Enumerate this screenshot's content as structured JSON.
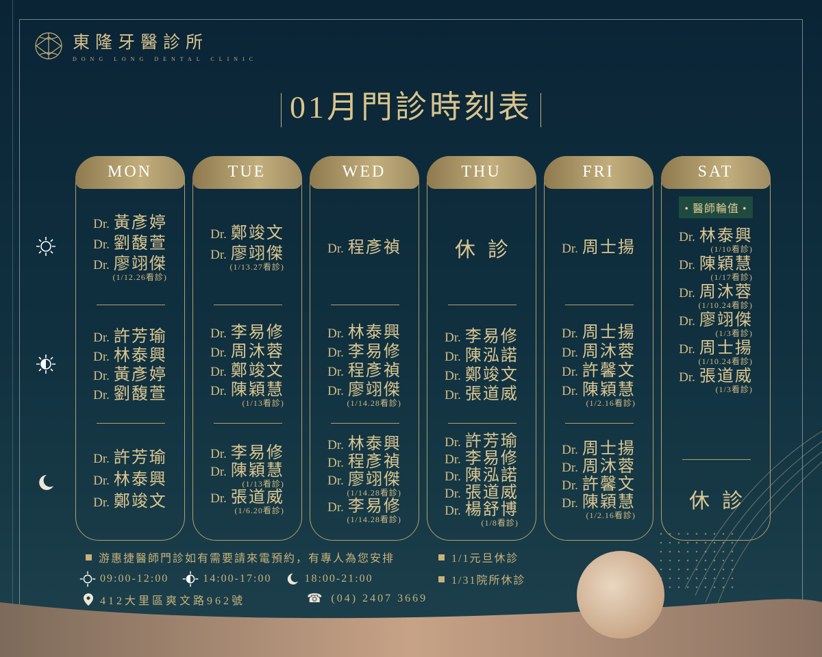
{
  "clinic": {
    "name": "東隆牙醫診所",
    "name_en": "DONG LONG DENTAL CLINIC"
  },
  "title": "01月門診時刻表",
  "prefix": "Dr.",
  "slots": [
    {
      "icon": "sun-icon"
    },
    {
      "icon": "half-sun-icon"
    },
    {
      "icon": "moon-icon"
    }
  ],
  "days": [
    {
      "label": "MON",
      "morning": [
        {
          "name": "黃彥婷"
        },
        {
          "name": "劉馥萱"
        },
        {
          "name": "廖翊傑",
          "note": "(1/12.26看診)"
        }
      ],
      "afternoon": [
        {
          "name": "許芳瑜"
        },
        {
          "name": "林泰興"
        },
        {
          "name": "黃彥婷"
        },
        {
          "name": "劉馥萱"
        }
      ],
      "evening": [
        {
          "name": "許芳瑜"
        },
        {
          "name": "林泰興"
        },
        {
          "name": "鄭竣文"
        }
      ]
    },
    {
      "label": "TUE",
      "morning": [
        {
          "name": "鄭竣文"
        },
        {
          "name": "廖翊傑",
          "note": "(1/13.27看診)"
        }
      ],
      "afternoon": [
        {
          "name": "李易修"
        },
        {
          "name": "周沐蓉"
        },
        {
          "name": "鄭竣文"
        },
        {
          "name": "陳穎慧",
          "note": "(1/13看診)"
        }
      ],
      "evening": [
        {
          "name": "李易修"
        },
        {
          "name": "陳穎慧",
          "note": "(1/13看診)"
        },
        {
          "name": "張道威",
          "note": "(1/6.20看診)"
        }
      ]
    },
    {
      "label": "WED",
      "morning": [
        {
          "name": "程彥禎"
        }
      ],
      "afternoon": [
        {
          "name": "林泰興"
        },
        {
          "name": "李易修"
        },
        {
          "name": "程彥禎"
        },
        {
          "name": "廖翊傑",
          "note": "(1/14.28看診)"
        }
      ],
      "evening": [
        {
          "name": "林泰興"
        },
        {
          "name": "程彥禎"
        },
        {
          "name": "廖翊傑",
          "note": "(1/14.28看診)"
        },
        {
          "name": "李易修",
          "note": "(1/14.28看診)"
        }
      ]
    },
    {
      "label": "THU",
      "morning_closed": "休診",
      "afternoon": [
        {
          "name": "李易修"
        },
        {
          "name": "陳泓諾"
        },
        {
          "name": "鄭竣文"
        },
        {
          "name": "張道威"
        }
      ],
      "evening": [
        {
          "name": "許芳瑜"
        },
        {
          "name": "李易修"
        },
        {
          "name": "陳泓諾"
        },
        {
          "name": "張道威"
        },
        {
          "name": "楊舒博",
          "note": "(1/8看診)"
        }
      ]
    },
    {
      "label": "FRI",
      "morning": [
        {
          "name": "周士揚"
        }
      ],
      "afternoon": [
        {
          "name": "周士揚"
        },
        {
          "name": "周沐蓉"
        },
        {
          "name": "許馨文"
        },
        {
          "name": "陳穎慧",
          "note": "(1/2.16看診)"
        }
      ],
      "evening": [
        {
          "name": "周士揚"
        },
        {
          "name": "周沐蓉"
        },
        {
          "name": "許馨文"
        },
        {
          "name": "陳穎慧",
          "note": "(1/2.16看診)"
        }
      ]
    },
    {
      "label": "SAT",
      "badge": "• 醫師輪值 •",
      "day": [
        {
          "name": "林泰興",
          "note": "(1/10看診)"
        },
        {
          "name": "陳穎慧",
          "note": "(1/17看診)"
        },
        {
          "name": "周沐蓉",
          "note": "(1/10.24看診)"
        },
        {
          "name": "廖翊傑",
          "note": "(1/3看診)"
        },
        {
          "name": "周士揚",
          "note": "(1/10.24看診)"
        },
        {
          "name": "張道威",
          "note": "(1/3看診)"
        }
      ],
      "evening_closed": "休診"
    }
  ],
  "footer": {
    "note": "游惠捷醫師門診如有需要請來電預約，有專人為您安排",
    "holiday1": "1/1元旦休診",
    "holiday2": "1/31院所休診",
    "hours": [
      "09:00-12:00",
      "14:00-17:00",
      "18:00-21:00"
    ],
    "address": "412大里區爽文路962號",
    "phone": "(04) 2407 3669"
  },
  "colors": {
    "gold": "#c9b27a",
    "navy": "#0a2436"
  }
}
